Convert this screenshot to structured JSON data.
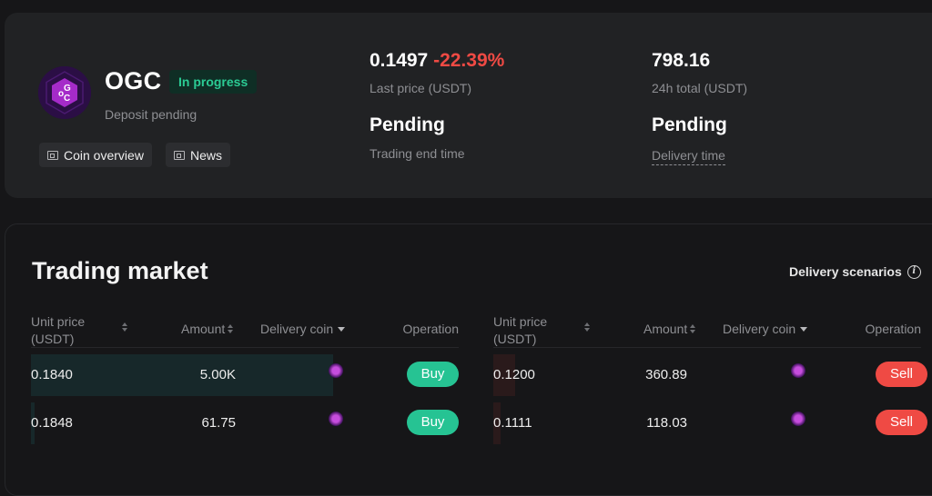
{
  "coin": {
    "symbol": "OGC",
    "logo_icon": "ogc-hexagon-logo",
    "logo_colors": {
      "outer": "#2b0e45",
      "inner": "#a52bc9"
    },
    "status_badge": "In progress",
    "deposit_status": "Deposit pending",
    "links": [
      {
        "label": "Coin overview",
        "icon": "document-icon"
      },
      {
        "label": "News",
        "icon": "document-icon"
      }
    ]
  },
  "stats": {
    "last_price": "0.1497",
    "price_change": "-22.39%",
    "last_price_label": "Last price (USDT)",
    "total_24h": "798.16",
    "total_24h_label": "24h total (USDT)",
    "trading_end": "Pending",
    "trading_end_label": "Trading end time",
    "delivery": "Pending",
    "delivery_label": "Delivery time"
  },
  "market": {
    "title": "Trading market",
    "scenarios_label": "Delivery scenarios",
    "columns": {
      "price": "Unit price (USDT)",
      "amount": "Amount",
      "coin": "Delivery coin",
      "operation": "Operation"
    },
    "buy_orders": [
      {
        "price": "0.1840",
        "amount": "5.00K",
        "depth": 1.0,
        "action": "Buy"
      },
      {
        "price": "0.1848",
        "amount": "61.75",
        "depth": 0.012,
        "action": "Buy"
      }
    ],
    "sell_orders": [
      {
        "price": "0.1200",
        "amount": "360.89",
        "depth": 0.072,
        "action": "Sell"
      },
      {
        "price": "0.1111",
        "amount": "118.03",
        "depth": 0.024,
        "action": "Sell"
      }
    ]
  },
  "colors": {
    "buy": "#26c393",
    "sell": "#ef4a44",
    "badge_text": "#2bcb94"
  }
}
